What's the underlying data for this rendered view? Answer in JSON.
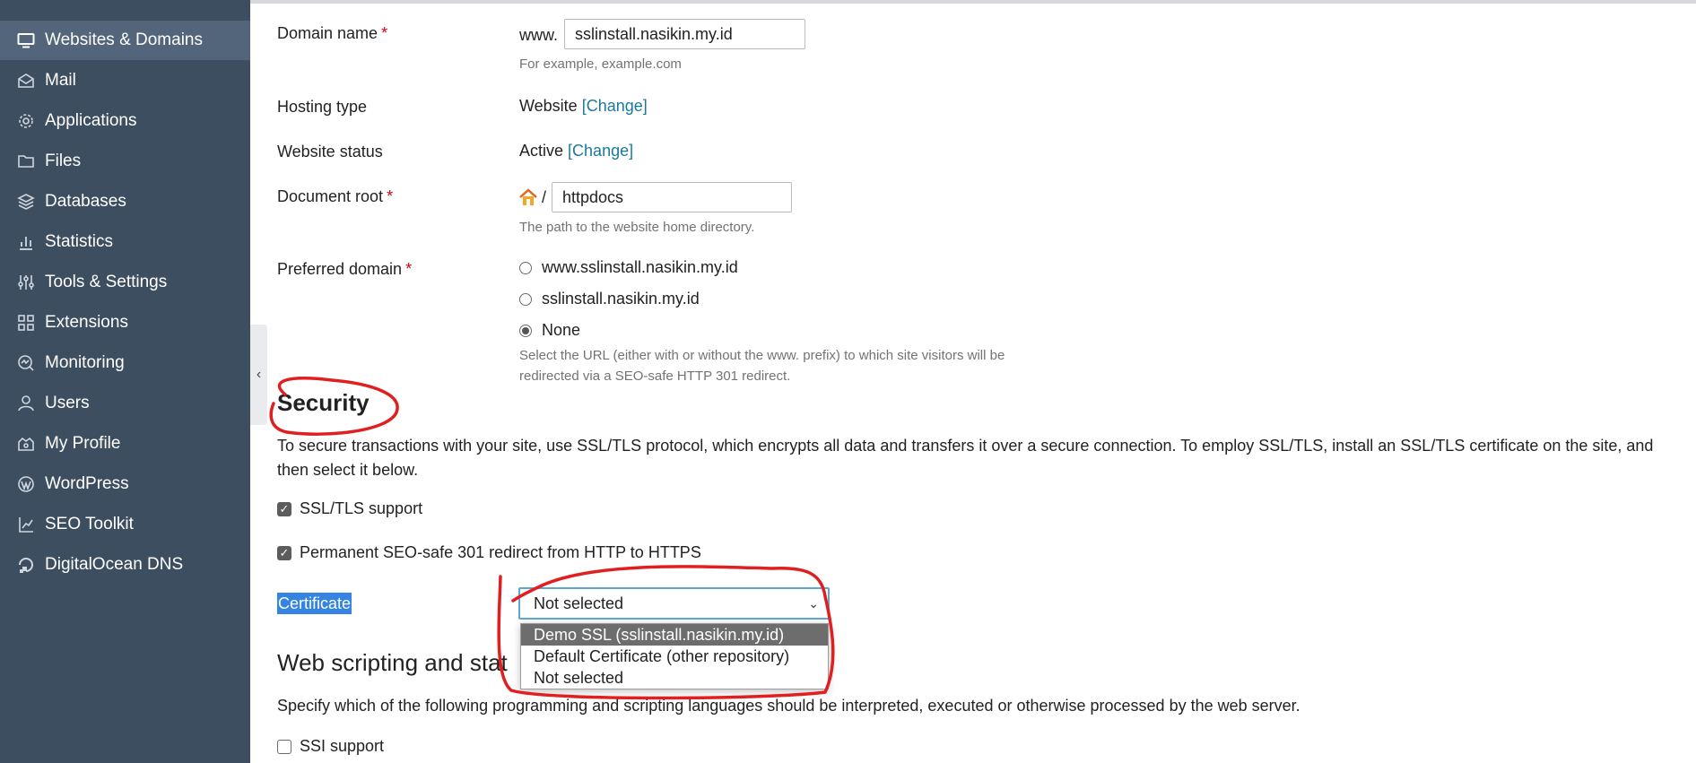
{
  "sidebar": {
    "items": [
      {
        "label": "Websites & Domains",
        "icon": "monitor-icon",
        "active": true
      },
      {
        "label": "Mail",
        "icon": "mail-icon"
      },
      {
        "label": "Applications",
        "icon": "gear-icon"
      },
      {
        "label": "Files",
        "icon": "folder-icon"
      },
      {
        "label": "Databases",
        "icon": "database-icon"
      },
      {
        "label": "Statistics",
        "icon": "bar-chart-icon"
      },
      {
        "label": "Tools & Settings",
        "icon": "sliders-icon"
      },
      {
        "label": "Extensions",
        "icon": "grid-icon"
      },
      {
        "label": "Monitoring",
        "icon": "monitoring-icon"
      },
      {
        "label": "Users",
        "icon": "user-icon"
      },
      {
        "label": "My Profile",
        "icon": "profile-icon"
      },
      {
        "label": "WordPress",
        "icon": "wordpress-icon"
      },
      {
        "label": "SEO Toolkit",
        "icon": "trend-chart-icon"
      },
      {
        "label": "DigitalOcean DNS",
        "icon": "digitalocean-icon"
      }
    ],
    "collapse_glyph": "‹"
  },
  "form": {
    "domain_name": {
      "label": "Domain name",
      "required": "*",
      "prefix": "www.",
      "value": "sslinstall.nasikin.my.id",
      "hint": "For example, example.com"
    },
    "hosting_type": {
      "label": "Hosting type",
      "value": "Website",
      "change": "[Change]"
    },
    "website_status": {
      "label": "Website status",
      "value": "Active",
      "change": "[Change]"
    },
    "document_root": {
      "label": "Document root",
      "required": "*",
      "separator": "/",
      "value": "httpdocs",
      "hint": "The path to the website home directory."
    },
    "preferred_domain": {
      "label": "Preferred domain",
      "required": "*",
      "options": [
        "www.sslinstall.nasikin.my.id",
        "sslinstall.nasikin.my.id",
        "None"
      ],
      "selected": "None",
      "hint_line1": "Select the URL (either with or without the www. prefix) to which site visitors will be",
      "hint_line2": "redirected via a SEO-safe HTTP 301 redirect."
    }
  },
  "security": {
    "heading": "Security",
    "description_line1": "To secure transactions with your site, use SSL/TLS protocol, which encrypts all data and transfers it over a secure connection. To employ SSL/TLS, install an SSL/TLS certificate on the site, and",
    "description_line2": "then select it below.",
    "ssl_support": {
      "label": "SSL/TLS support",
      "checked": true
    },
    "redirect_301": {
      "label": "Permanent SEO-safe 301 redirect from HTTP to HTTPS",
      "checked": true
    },
    "certificate": {
      "label": "Certificate",
      "selected": "Not selected",
      "options": [
        "Demo SSL (sslinstall.nasikin.my.id)",
        "Default Certificate (other repository)",
        "Not selected"
      ],
      "highlighted": "Demo SSL (sslinstall.nasikin.my.id)"
    }
  },
  "web_scripting": {
    "heading": "Web scripting and stat",
    "description": "Specify which of the following programming and scripting languages should be interpreted, executed or otherwise processed by the web server.",
    "ssi_support": {
      "label": "SSI support",
      "checked": false
    }
  },
  "colors": {
    "sidebar_bg": "#3e4e61",
    "sidebar_active": "#53657a",
    "link": "#1b7a9a",
    "required": "#d0021b",
    "annotation": "#e02020"
  }
}
